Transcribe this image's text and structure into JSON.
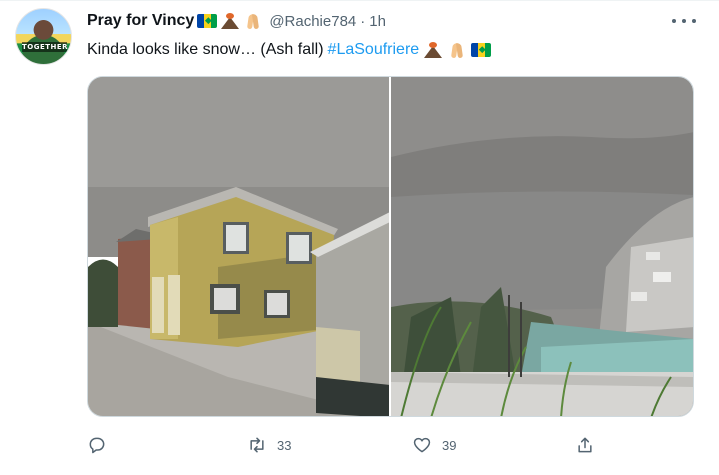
{
  "tweet": {
    "author": {
      "display_name": "Pray for Vincy",
      "handle": "@Rachie784",
      "time": "1h",
      "avatar_caption": "TOGETHER"
    },
    "separator": "·",
    "text": "Kinda looks like snow… (Ash fall)",
    "hashtag": "#LaSoufriere",
    "name_emoji": [
      "flag-st-vincent",
      "volcano",
      "folded-hands"
    ],
    "text_emoji": [
      "volcano",
      "folded-hands",
      "flag-st-vincent"
    ],
    "media": [
      {
        "kind": "photo",
        "subject": "ash-covered two-story yellow house on a street"
      },
      {
        "kind": "photo",
        "subject": "ash-covered hillside town overlooking the sea"
      }
    ],
    "actions": {
      "reply": {
        "icon": "reply-icon",
        "count": ""
      },
      "retweet": {
        "icon": "retweet-icon",
        "count": "33"
      },
      "like": {
        "icon": "heart-icon",
        "count": "39"
      },
      "share": {
        "icon": "share-icon",
        "count": ""
      }
    },
    "colors": {
      "link": "#1d9bf0",
      "secondary_text": "#536471",
      "primary_text": "#0f1419",
      "border": "#cfd9de"
    }
  }
}
